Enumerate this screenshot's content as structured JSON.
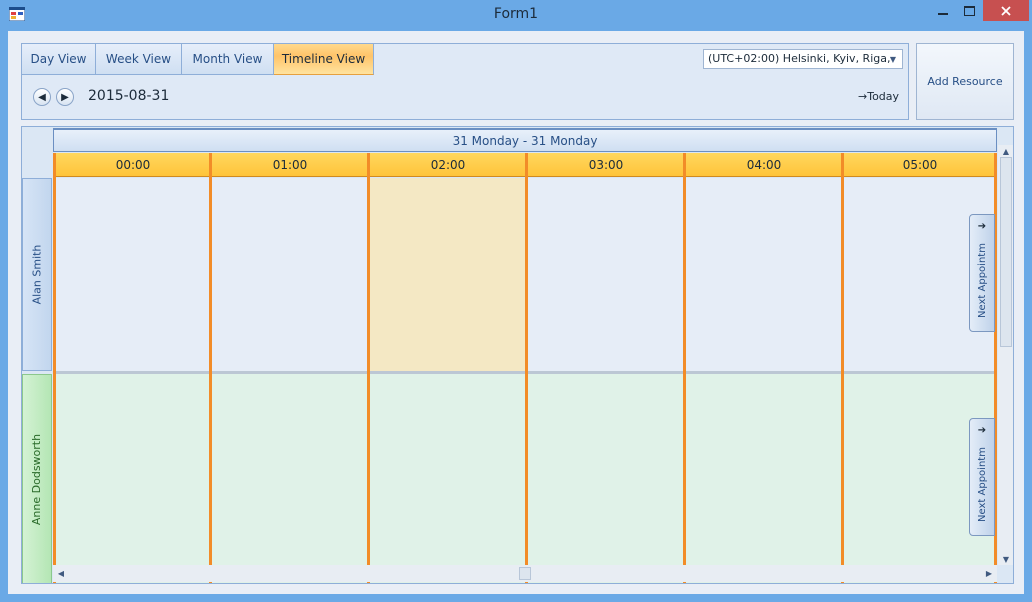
{
  "window": {
    "title": "Form1"
  },
  "toolbar": {
    "tabs": [
      {
        "label": "Day View"
      },
      {
        "label": "Week View"
      },
      {
        "label": "Month View"
      },
      {
        "label": "Timeline View"
      }
    ],
    "active_tab": "Timeline View",
    "timezone": "(UTC+02:00) Helsinki, Kyiv, Riga,",
    "date": "2015-08-31",
    "today_label": "Today"
  },
  "add_resource_label": "Add Resource",
  "scheduler": {
    "range_label": "31 Monday - 31 Monday",
    "hours": [
      "00:00",
      "01:00",
      "02:00",
      "03:00",
      "04:00",
      "05:00"
    ],
    "highlighted_hour": "02:00",
    "resources": [
      {
        "name": "Alan Smith",
        "color": "#e6edf7"
      },
      {
        "name": "Anne Dodsworth",
        "color": "#e0f2e8"
      }
    ],
    "next_appointment_label": "Next Appointm"
  },
  "colors": {
    "accent": "#f28c28",
    "active_tab": "#ffc46a",
    "title_bar": "#6aa9e6"
  }
}
